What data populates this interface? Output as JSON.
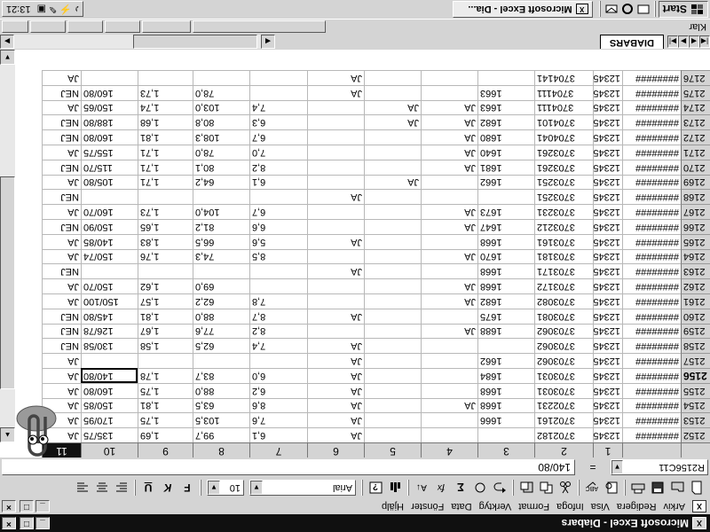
{
  "window": {
    "title": "Microsoft Excel - Diabars",
    "doc_icon": "X",
    "min": "_",
    "restore": "□",
    "close": "×"
  },
  "menu": {
    "items": [
      "Arkiv",
      "Redigera",
      "Visa",
      "Infoga",
      "Format",
      "Verktyg",
      "Data",
      "Fönster",
      "Hjälp"
    ]
  },
  "toolbar": {
    "font_name": "Arial",
    "font_size": "10",
    "buttons": [
      "new-icon",
      "open-icon",
      "save-icon",
      "print-icon",
      "preview-icon",
      "spelling-icon",
      "cut-icon",
      "copy-icon",
      "paste-icon",
      "undo-icon",
      "autosum-icon",
      "function-icon",
      "sort-icon",
      "chart-icon",
      "help-icon",
      "bold-icon",
      "italic-icon",
      "underline-icon",
      "align-left-icon",
      "align-center-icon",
      "align-right-icon"
    ]
  },
  "formula": {
    "name_box": "R2156C11",
    "equals": "=",
    "content": "140/80"
  },
  "columns": [
    "1",
    "2",
    "3",
    "4",
    "5",
    "6",
    "7",
    "8",
    "9",
    "10",
    "11"
  ],
  "selected_column": "11",
  "active_row": "2156",
  "rows": [
    {
      "n": "2152",
      "c": [
        "########",
        "12345",
        "3702182",
        "",
        "",
        "",
        "JA",
        "6,1",
        "99,7",
        "1,69",
        "135/75",
        "JA"
      ]
    },
    {
      "n": "2153",
      "c": [
        "########",
        "12345",
        "3702161",
        "1666",
        "",
        "",
        "JA",
        "7,6",
        "103,5",
        "1,75",
        "170/95",
        "JA"
      ]
    },
    {
      "n": "2154",
      "c": [
        "########",
        "12345",
        "3702231",
        "1668",
        "JA",
        "",
        "JA",
        "8,6",
        "63,5",
        "1,81",
        "150/85",
        "JA"
      ]
    },
    {
      "n": "2155",
      "c": [
        "########",
        "12345",
        "3703031",
        "1668",
        "",
        "",
        "JA",
        "6,2",
        "88,0",
        "1,75",
        "160/80",
        "JA"
      ]
    },
    {
      "n": "2156",
      "c": [
        "########",
        "12345",
        "3703031",
        "1684",
        "",
        "",
        "JA",
        "6,0",
        "83,7",
        "1,78",
        "140/80",
        "JA"
      ]
    },
    {
      "n": "2157",
      "c": [
        "########",
        "12345",
        "3703062",
        "1662",
        "",
        "",
        "JA",
        "",
        "",
        "",
        "",
        "JA"
      ]
    },
    {
      "n": "2158",
      "c": [
        "########",
        "12345",
        "3703062",
        "",
        "",
        "",
        "JA",
        "7,4",
        "62,5",
        "1,58",
        "130/58",
        "NEJ"
      ]
    },
    {
      "n": "2159",
      "c": [
        "########",
        "12345",
        "3703062",
        "1688",
        "JA",
        "",
        "",
        "8,2",
        "77,6",
        "1,67",
        "126/78",
        "NEJ"
      ]
    },
    {
      "n": "2160",
      "c": [
        "########",
        "12345",
        "3703081",
        "1675",
        "",
        "",
        "JA",
        "8,7",
        "88,0",
        "1,81",
        "145/80",
        "NEJ"
      ]
    },
    {
      "n": "2161",
      "c": [
        "########",
        "12345",
        "3703082",
        "1682",
        "JA",
        "",
        "",
        "7,8",
        "62,2",
        "1,57",
        "150/100",
        "JA"
      ]
    },
    {
      "n": "2162",
      "c": [
        "########",
        "12345",
        "3703172",
        "1668",
        "JA",
        "",
        "",
        "",
        "69,0",
        "1,62",
        "150/70",
        "JA"
      ]
    },
    {
      "n": "2163",
      "c": [
        "########",
        "12345",
        "3703171",
        "1668",
        "",
        "",
        "JA",
        "",
        "",
        "",
        "",
        "NEJ"
      ]
    },
    {
      "n": "2164",
      "c": [
        "########",
        "12345",
        "3703181",
        "1670",
        "JA",
        "",
        "",
        "8,5",
        "74,3",
        "1,76",
        "150/74",
        "JA"
      ]
    },
    {
      "n": "2165",
      "c": [
        "########",
        "12345",
        "3703161",
        "1668",
        "",
        "",
        "JA",
        "5,6",
        "66,5",
        "1,83",
        "140/85",
        "JA"
      ]
    },
    {
      "n": "2166",
      "c": [
        "########",
        "12345",
        "3703212",
        "1647",
        "JA",
        "",
        "",
        "6,6",
        "81,2",
        "1,65",
        "150/90",
        "NEJ"
      ]
    },
    {
      "n": "2167",
      "c": [
        "########",
        "12345",
        "3703231",
        "1673",
        "JA",
        "",
        "",
        "6,7",
        "104,0",
        "1,73",
        "160/70",
        "JA"
      ]
    },
    {
      "n": "2168",
      "c": [
        "########",
        "12345",
        "3703251",
        "",
        "",
        "",
        "JA",
        "",
        "",
        "",
        "",
        "NEJ"
      ]
    },
    {
      "n": "2169",
      "c": [
        "########",
        "12345",
        "3703251",
        "1662",
        "",
        "JA",
        "",
        "6,1",
        "64,2",
        "1,71",
        "105/80",
        "JA"
      ]
    },
    {
      "n": "2170",
      "c": [
        "########",
        "12345",
        "3703261",
        "1681",
        "JA",
        "",
        "",
        "8,2",
        "80,1",
        "1,71",
        "115/70",
        "NEJ"
      ]
    },
    {
      "n": "2171",
      "c": [
        "########",
        "12345",
        "3703261",
        "1640",
        "JA",
        "",
        "",
        "7,0",
        "78,0",
        "1,71",
        "155/75",
        "JA"
      ]
    },
    {
      "n": "2172",
      "c": [
        "########",
        "12345",
        "3704041",
        "1680",
        "JA",
        "",
        "",
        "6,7",
        "108,3",
        "1,81",
        "160/80",
        "NEJ"
      ]
    },
    {
      "n": "2173",
      "c": [
        "########",
        "12345",
        "3704101",
        "1682",
        "JA",
        "JA",
        "",
        "6,3",
        "80,8",
        "1,68",
        "188/80",
        "NEJ"
      ]
    },
    {
      "n": "2174",
      "c": [
        "########",
        "12345",
        "3704111",
        "1663",
        "JA",
        "JA",
        "",
        "7,4",
        "103,0",
        "1,74",
        "150/65",
        "JA"
      ]
    },
    {
      "n": "2175",
      "c": [
        "########",
        "12345",
        "3704111",
        "1663",
        "",
        "",
        "JA",
        "",
        "78,0",
        "1,73",
        "160/80",
        "NEJ"
      ]
    },
    {
      "n": "2176",
      "c": [
        "########",
        "12345",
        "3704141",
        "",
        "",
        "",
        "JA",
        "",
        "",
        "",
        "",
        "JA"
      ]
    }
  ],
  "tabs": {
    "sheet": "DIABARS"
  },
  "status": {
    "text": "Klar"
  },
  "taskbar": {
    "start": "Start",
    "task": "Microsoft Excel - Dia...",
    "clock": "13:21"
  }
}
